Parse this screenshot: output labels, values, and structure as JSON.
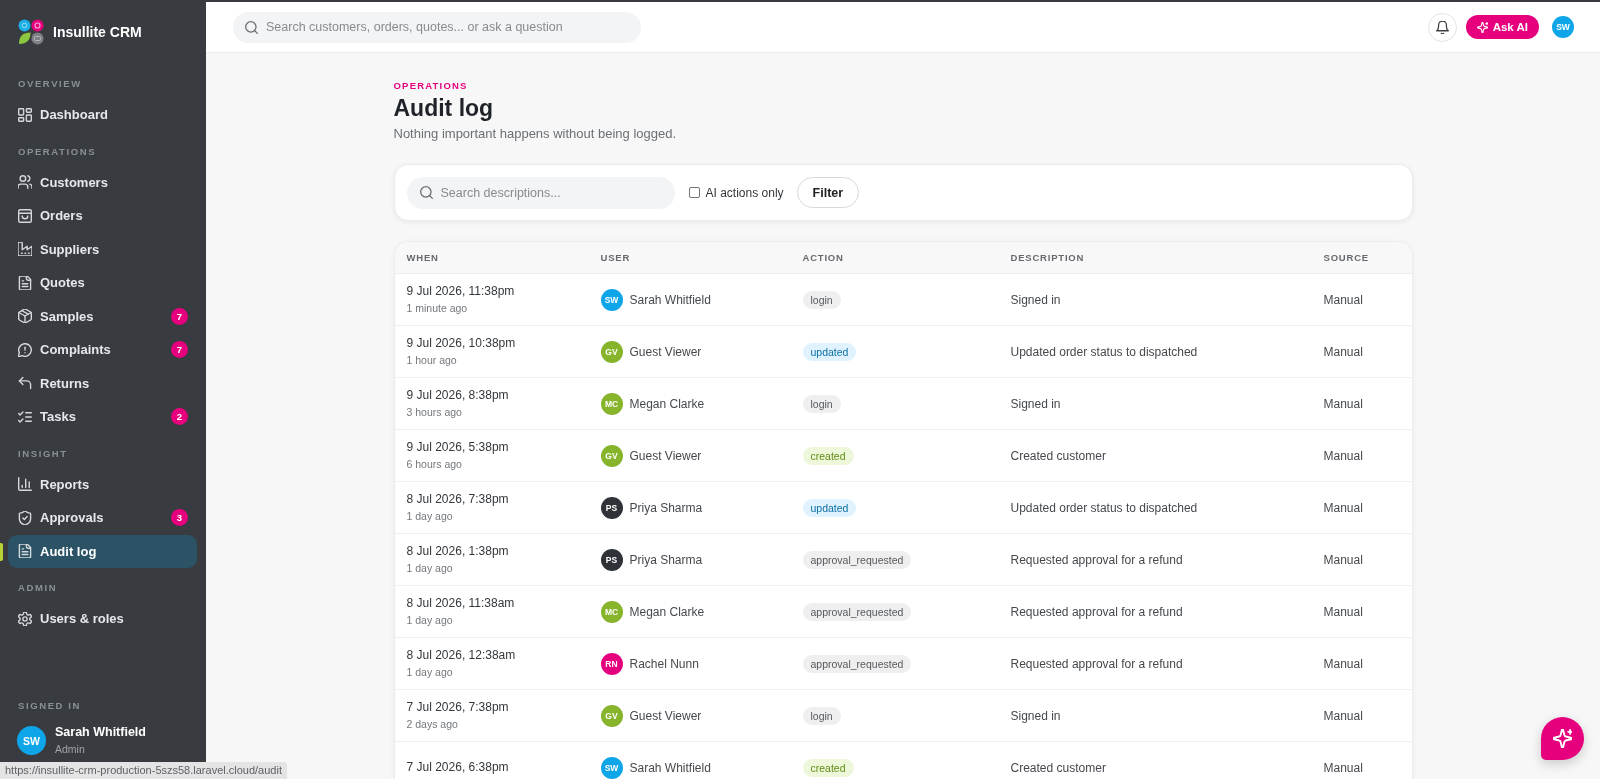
{
  "sidebar": {
    "brand": "Insullite CRM",
    "sections": [
      {
        "label": "OVERVIEW",
        "items": [
          {
            "label": "Dashboard",
            "selected": false
          }
        ]
      },
      {
        "label": "OPERATIONS",
        "items": [
          {
            "label": "Customers",
            "selected": false
          },
          {
            "label": "Orders",
            "selected": false
          },
          {
            "label": "Suppliers",
            "selected": false
          },
          {
            "label": "Quotes",
            "selected": false
          },
          {
            "label": "Samples",
            "selected": false,
            "badge": "7"
          },
          {
            "label": "Complaints",
            "selected": false,
            "badge": "7"
          },
          {
            "label": "Returns",
            "selected": false
          },
          {
            "label": "Tasks",
            "selected": false,
            "badge": "2"
          }
        ]
      },
      {
        "label": "INSIGHT",
        "items": [
          {
            "label": "Reports",
            "selected": false
          },
          {
            "label": "Approvals",
            "selected": false,
            "badge": "3"
          },
          {
            "label": "Audit log",
            "selected": true
          }
        ]
      },
      {
        "label": "ADMIN",
        "items": [
          {
            "label": "Users & roles",
            "selected": false
          }
        ]
      }
    ],
    "signed_in": {
      "label": "SIGNED IN",
      "initials": "SW",
      "name": "Sarah Whitfield",
      "role": "Admin"
    }
  },
  "topbar": {
    "search": {
      "placeholder": "Search customers, orders, quotes... or ask a question"
    },
    "ask_ai": "Ask AI",
    "avatar": "SW"
  },
  "page": {
    "eyebrow": "OPERATIONS",
    "title": "Audit log",
    "subtitle": "Nothing important happens without being logged."
  },
  "filters": {
    "search": {
      "placeholder": "Search descriptions..."
    },
    "ai_only": {
      "label": "AI actions only",
      "checked": false
    },
    "button": "Filter"
  },
  "table": {
    "columns": [
      "WHEN",
      "USER",
      "ACTION",
      "DESCRIPTION",
      "SOURCE"
    ],
    "rows": [
      {
        "when": "9 Jul 2026, 11:38pm",
        "ago": "1 minute ago",
        "user": {
          "initials": "SW",
          "name": "Sarah Whitfield",
          "color": "#0ea5e9"
        },
        "action": {
          "label": "login",
          "kind": "neutral"
        },
        "description": "Signed in",
        "source": "Manual"
      },
      {
        "when": "9 Jul 2026, 10:38pm",
        "ago": "1 hour ago",
        "user": {
          "initials": "GV",
          "name": "Guest Viewer",
          "color": "#86b52b"
        },
        "action": {
          "label": "updated",
          "kind": "info"
        },
        "description": "Updated order status to dispatched",
        "source": "Manual"
      },
      {
        "when": "9 Jul 2026, 8:38pm",
        "ago": "3 hours ago",
        "user": {
          "initials": "MC",
          "name": "Megan Clarke",
          "color": "#86b52b"
        },
        "action": {
          "label": "login",
          "kind": "neutral"
        },
        "description": "Signed in",
        "source": "Manual"
      },
      {
        "when": "9 Jul 2026, 5:38pm",
        "ago": "6 hours ago",
        "user": {
          "initials": "GV",
          "name": "Guest Viewer",
          "color": "#86b52b"
        },
        "action": {
          "label": "created",
          "kind": "success"
        },
        "description": "Created customer",
        "source": "Manual"
      },
      {
        "when": "8 Jul 2026, 7:38pm",
        "ago": "1 day ago",
        "user": {
          "initials": "PS",
          "name": "Priya Sharma",
          "color": "#2f3337"
        },
        "action": {
          "label": "updated",
          "kind": "info"
        },
        "description": "Updated order status to dispatched",
        "source": "Manual"
      },
      {
        "when": "8 Jul 2026, 1:38pm",
        "ago": "1 day ago",
        "user": {
          "initials": "PS",
          "name": "Priya Sharma",
          "color": "#2f3337"
        },
        "action": {
          "label": "approval_requested",
          "kind": "neutral"
        },
        "description": "Requested approval for a refund",
        "source": "Manual"
      },
      {
        "when": "8 Jul 2026, 11:38am",
        "ago": "1 day ago",
        "user": {
          "initials": "MC",
          "name": "Megan Clarke",
          "color": "#86b52b"
        },
        "action": {
          "label": "approval_requested",
          "kind": "neutral"
        },
        "description": "Requested approval for a refund",
        "source": "Manual"
      },
      {
        "when": "8 Jul 2026, 12:38am",
        "ago": "1 day ago",
        "user": {
          "initials": "RN",
          "name": "Rachel Nunn",
          "color": "#e6007e"
        },
        "action": {
          "label": "approval_requested",
          "kind": "neutral"
        },
        "description": "Requested approval for a refund",
        "source": "Manual"
      },
      {
        "when": "7 Jul 2026, 7:38pm",
        "ago": "2 days ago",
        "user": {
          "initials": "GV",
          "name": "Guest Viewer",
          "color": "#86b52b"
        },
        "action": {
          "label": "login",
          "kind": "neutral"
        },
        "description": "Signed in",
        "source": "Manual"
      },
      {
        "when": "7 Jul 2026, 6:38pm",
        "user": {
          "initials": "SW",
          "name": "Sarah Whitfield",
          "color": "#0ea5e9"
        },
        "action": {
          "label": "created",
          "kind": "success"
        },
        "description": "Created customer",
        "source": "Manual"
      }
    ]
  },
  "status_url": "https://insullite-crm-production-5szs58.laravel.cloud/audit"
}
